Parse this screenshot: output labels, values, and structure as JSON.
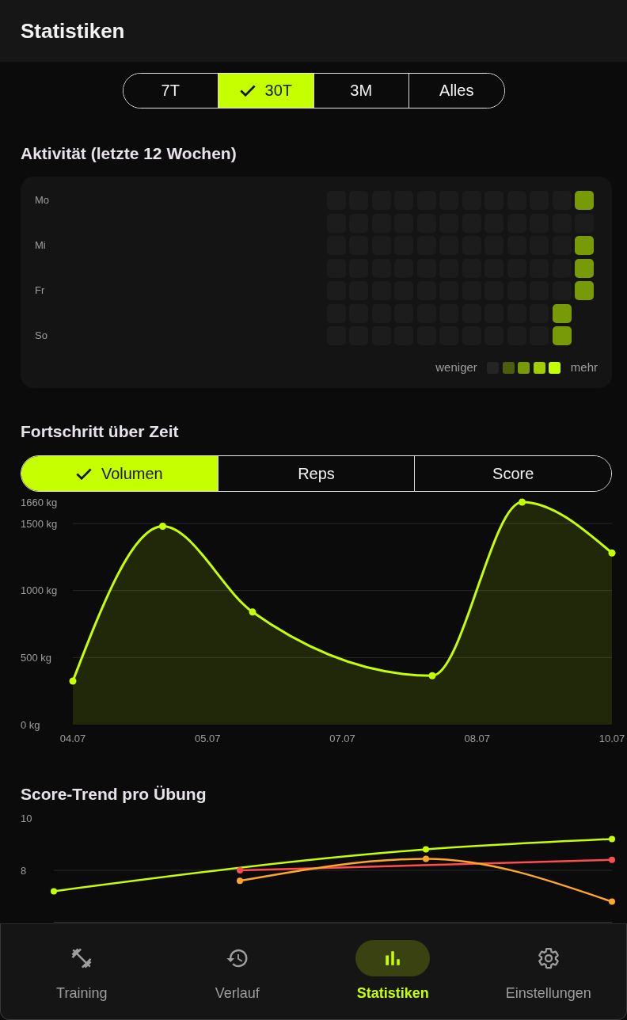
{
  "header": {
    "title": "Statistiken"
  },
  "period_tabs": [
    {
      "label": "7T",
      "selected": false
    },
    {
      "label": "30T",
      "selected": true
    },
    {
      "label": "3M",
      "selected": false
    },
    {
      "label": "Alles",
      "selected": false
    }
  ],
  "activity": {
    "title": "Aktivität (letzte 12 Wochen)",
    "day_labels": [
      "Mo",
      "Mi",
      "Fr",
      "So"
    ],
    "weeks": [
      {
        "days": [
          {
            "color": "#1c1c1c"
          },
          {
            "color": "#1c1c1c"
          },
          {
            "color": "#1c1c1c"
          },
          {
            "color": "#1c1c1c"
          },
          {
            "color": "#1c1c1c"
          },
          {
            "color": "#1c1c1c"
          },
          {
            "color": "#1c1c1c"
          }
        ]
      },
      {
        "days": [
          {
            "color": "#1c1c1c"
          },
          {
            "color": "#1c1c1c"
          },
          {
            "color": "#1c1c1c"
          },
          {
            "color": "#1c1c1c"
          },
          {
            "color": "#1c1c1c"
          },
          {
            "color": "#1c1c1c"
          },
          {
            "color": "#1c1c1c"
          }
        ]
      },
      {
        "days": [
          {
            "color": "#1c1c1c"
          },
          {
            "color": "#1c1c1c"
          },
          {
            "color": "#1c1c1c"
          },
          {
            "color": "#1c1c1c"
          },
          {
            "color": "#1c1c1c"
          },
          {
            "color": "#1c1c1c"
          },
          {
            "color": "#1c1c1c"
          }
        ]
      },
      {
        "days": [
          {
            "color": "#1c1c1c"
          },
          {
            "color": "#1c1c1c"
          },
          {
            "color": "#1c1c1c"
          },
          {
            "color": "#1c1c1c"
          },
          {
            "color": "#1c1c1c"
          },
          {
            "color": "#1c1c1c"
          },
          {
            "color": "#1c1c1c"
          }
        ]
      },
      {
        "days": [
          {
            "color": "#1c1c1c"
          },
          {
            "color": "#1c1c1c"
          },
          {
            "color": "#1c1c1c"
          },
          {
            "color": "#1c1c1c"
          },
          {
            "color": "#1c1c1c"
          },
          {
            "color": "#1c1c1c"
          },
          {
            "color": "#1c1c1c"
          }
        ]
      },
      {
        "days": [
          {
            "color": "#1c1c1c"
          },
          {
            "color": "#1c1c1c"
          },
          {
            "color": "#1c1c1c"
          },
          {
            "color": "#1c1c1c"
          },
          {
            "color": "#1c1c1c"
          },
          {
            "color": "#1c1c1c"
          },
          {
            "color": "#1c1c1c"
          }
        ]
      },
      {
        "days": [
          {
            "color": "#1c1c1c"
          },
          {
            "color": "#1c1c1c"
          },
          {
            "color": "#1c1c1c"
          },
          {
            "color": "#1c1c1c"
          },
          {
            "color": "#1c1c1c"
          },
          {
            "color": "#1c1c1c"
          },
          {
            "color": "#1c1c1c"
          }
        ]
      },
      {
        "days": [
          {
            "color": "#1c1c1c"
          },
          {
            "color": "#1c1c1c"
          },
          {
            "color": "#1c1c1c"
          },
          {
            "color": "#1c1c1c"
          },
          {
            "color": "#1c1c1c"
          },
          {
            "color": "#1c1c1c"
          },
          {
            "color": "#1c1c1c"
          }
        ]
      },
      {
        "days": [
          {
            "color": "#1c1c1c"
          },
          {
            "color": "#1c1c1c"
          },
          {
            "color": "#1c1c1c"
          },
          {
            "color": "#1c1c1c"
          },
          {
            "color": "#1c1c1c"
          },
          {
            "color": "#1c1c1c"
          },
          {
            "color": "#1c1c1c"
          }
        ]
      },
      {
        "days": [
          {
            "color": "#1c1c1c"
          },
          {
            "color": "#1c1c1c"
          },
          {
            "color": "#1c1c1c"
          },
          {
            "color": "#1c1c1c"
          },
          {
            "color": "#1c1c1c"
          },
          {
            "color": "#1c1c1c"
          },
          {
            "color": "#1c1c1c"
          }
        ]
      },
      {
        "days": [
          {
            "color": "#1c1c1c"
          },
          {
            "color": "#1c1c1c"
          },
          {
            "color": "#1c1c1c"
          },
          {
            "color": "#1c1c1c"
          },
          {
            "color": "#1c1c1c"
          },
          {
            "color": "#789a06"
          },
          {
            "color": "#789a06"
          }
        ]
      },
      {
        "days": [
          {
            "color": "#789a06"
          },
          {
            "color": "#1c1c1c"
          },
          {
            "color": "#789a06"
          },
          {
            "color": "#789a06"
          },
          {
            "color": "#789a06"
          }
        ]
      }
    ],
    "legend": {
      "less": "weniger",
      "more": "mehr",
      "swatches": [
        {
          "color": "#242424"
        },
        {
          "color": "#4b5e0e"
        },
        {
          "color": "#789a06"
        },
        {
          "color": "#a3cc00"
        },
        {
          "color": "#c6ff00"
        }
      ]
    }
  },
  "progress": {
    "title": "Fortschritt über Zeit",
    "metric_tabs": [
      {
        "label": "Volumen",
        "selected": true
      },
      {
        "label": "Reps",
        "selected": false
      },
      {
        "label": "Score",
        "selected": false
      }
    ],
    "chart_data": {
      "type": "area",
      "categories": [
        "04.07",
        null,
        null,
        "05.07",
        null,
        null,
        "07.07",
        null,
        null,
        "08.07",
        null,
        null,
        "10.07"
      ],
      "series": [
        {
          "color": "#c6ff00",
          "marker": true,
          "values": [
            325,
            null,
            1480,
            null,
            840,
            null,
            null,
            null,
            365,
            null,
            1660,
            null,
            1280
          ]
        }
      ],
      "ylim": [
        0,
        1660
      ],
      "grid": true,
      "yticks": [
        {
          "value": 0,
          "label": "0 kg"
        },
        {
          "value": 500,
          "label": "500 kg"
        },
        {
          "value": 1000,
          "label": "1000 kg"
        },
        {
          "value": 1500,
          "label": "1500 kg"
        },
        {
          "value": 1660,
          "label": "1660 kg"
        }
      ]
    }
  },
  "score_trend": {
    "title": "Score-Trend pro Übung",
    "chart_data": {
      "type": "line",
      "series": [
        {
          "color": "#c6ff00",
          "marker": true,
          "values": [
            6.5,
            null,
            8.5,
            9
          ]
        },
        {
          "color": "#ff4d4d",
          "marker": true,
          "values": [
            null,
            7.5,
            null,
            8
          ]
        },
        {
          "color": "#ffa726",
          "marker": true,
          "values": [
            null,
            7,
            8.05,
            6
          ]
        }
      ],
      "ylim": [
        5,
        10
      ],
      "grid": true,
      "yticks": [
        {
          "value": 7.5,
          "label": "8"
        },
        {
          "value": 10,
          "label": "10"
        }
      ]
    }
  },
  "nav": [
    {
      "label": "Training",
      "selected": false
    },
    {
      "label": "Verlauf",
      "selected": false
    },
    {
      "label": "Statistiken",
      "selected": true
    },
    {
      "label": "Einstellungen",
      "selected": false
    }
  ]
}
